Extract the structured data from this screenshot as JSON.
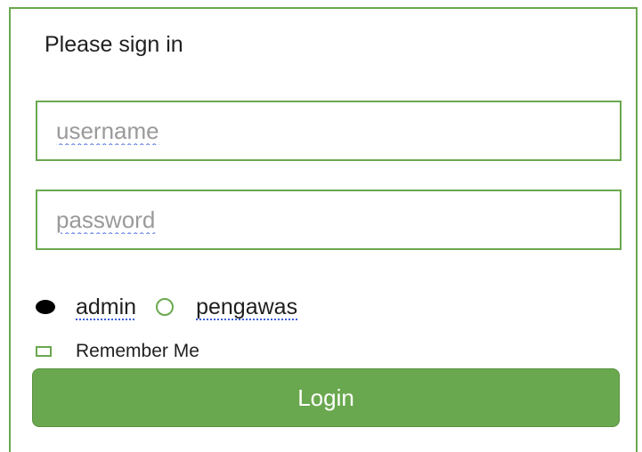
{
  "form": {
    "title": "Please sign in",
    "username": {
      "placeholder": "username",
      "value": ""
    },
    "password": {
      "placeholder": "password",
      "value": ""
    },
    "role_options": [
      {
        "label": "admin",
        "selected": true
      },
      {
        "label": "pengawas",
        "selected": false
      }
    ],
    "remember": {
      "label": "Remember Me",
      "checked": false
    },
    "login_label": "Login"
  },
  "colors": {
    "accent": "#6aa84f",
    "button_text": "#ffffff",
    "placeholder": "#9a9a9a"
  }
}
